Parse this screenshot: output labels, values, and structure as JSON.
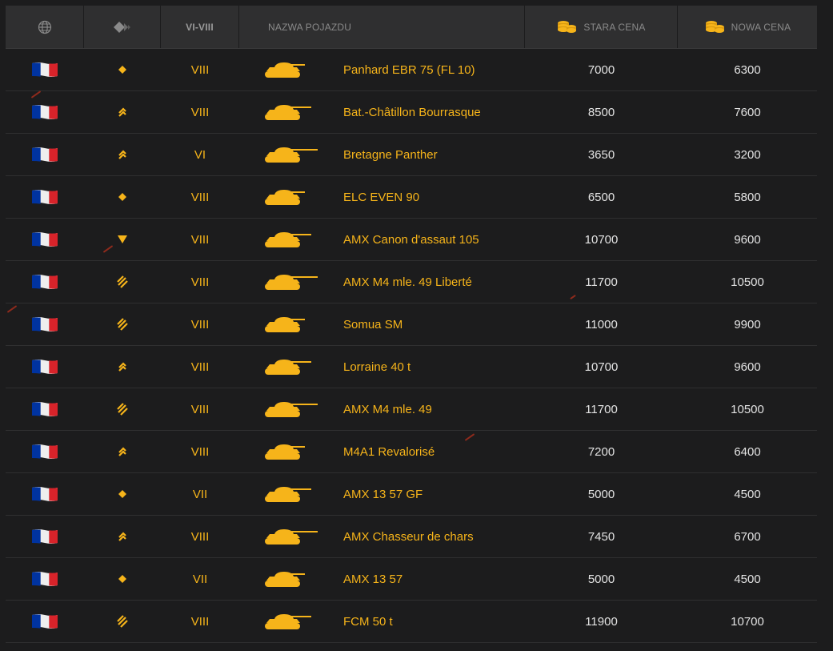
{
  "header": {
    "globe_icon": "globe-icon",
    "class_icon": "vehicle-class-icon",
    "tier_label": "VI-VIII",
    "name_label": "NAZWA POJAZDU",
    "old_price_label": "STARA CENA",
    "new_price_label": "NOWA CENA",
    "coin_icon": "gold-coins-icon"
  },
  "colors": {
    "accent": "#f6b41a",
    "background": "#1c1c1d",
    "header_bg": "#2f2f30",
    "flag_blue": "#0033a0",
    "flag_red": "#d8232a"
  },
  "rows": [
    {
      "nation": "France",
      "class": "light",
      "tier": "VIII",
      "name": "Panhard EBR 75 (FL 10)",
      "old": "7000",
      "new": "6300"
    },
    {
      "nation": "France",
      "class": "medium",
      "tier": "VIII",
      "name": "Bat.-Châtillon Bourrasque",
      "old": "8500",
      "new": "7600"
    },
    {
      "nation": "France",
      "class": "medium",
      "tier": "VI",
      "name": "Bretagne Panther",
      "old": "3650",
      "new": "3200"
    },
    {
      "nation": "France",
      "class": "light",
      "tier": "VIII",
      "name": "ELC EVEN 90",
      "old": "6500",
      "new": "5800"
    },
    {
      "nation": "France",
      "class": "td",
      "tier": "VIII",
      "name": "AMX Canon d'assaut 105",
      "old": "10700",
      "new": "9600"
    },
    {
      "nation": "France",
      "class": "heavy",
      "tier": "VIII",
      "name": "AMX M4 mle. 49 Liberté",
      "old": "11700",
      "new": "10500"
    },
    {
      "nation": "France",
      "class": "heavy",
      "tier": "VIII",
      "name": "Somua SM",
      "old": "11000",
      "new": "9900"
    },
    {
      "nation": "France",
      "class": "medium",
      "tier": "VIII",
      "name": "Lorraine 40 t",
      "old": "10700",
      "new": "9600"
    },
    {
      "nation": "France",
      "class": "heavy",
      "tier": "VIII",
      "name": "AMX M4 mle. 49",
      "old": "11700",
      "new": "10500"
    },
    {
      "nation": "France",
      "class": "medium",
      "tier": "VIII",
      "name": "M4A1 Revalorisé",
      "old": "7200",
      "new": "6400"
    },
    {
      "nation": "France",
      "class": "light",
      "tier": "VII",
      "name": "AMX 13 57 GF",
      "old": "5000",
      "new": "4500"
    },
    {
      "nation": "France",
      "class": "medium",
      "tier": "VIII",
      "name": "AMX Chasseur de chars",
      "old": "7450",
      "new": "6700"
    },
    {
      "nation": "France",
      "class": "light",
      "tier": "VII",
      "name": "AMX 13 57",
      "old": "5000",
      "new": "4500"
    },
    {
      "nation": "France",
      "class": "heavy",
      "tier": "VIII",
      "name": "FCM 50 t",
      "old": "11900",
      "new": "10700"
    }
  ]
}
